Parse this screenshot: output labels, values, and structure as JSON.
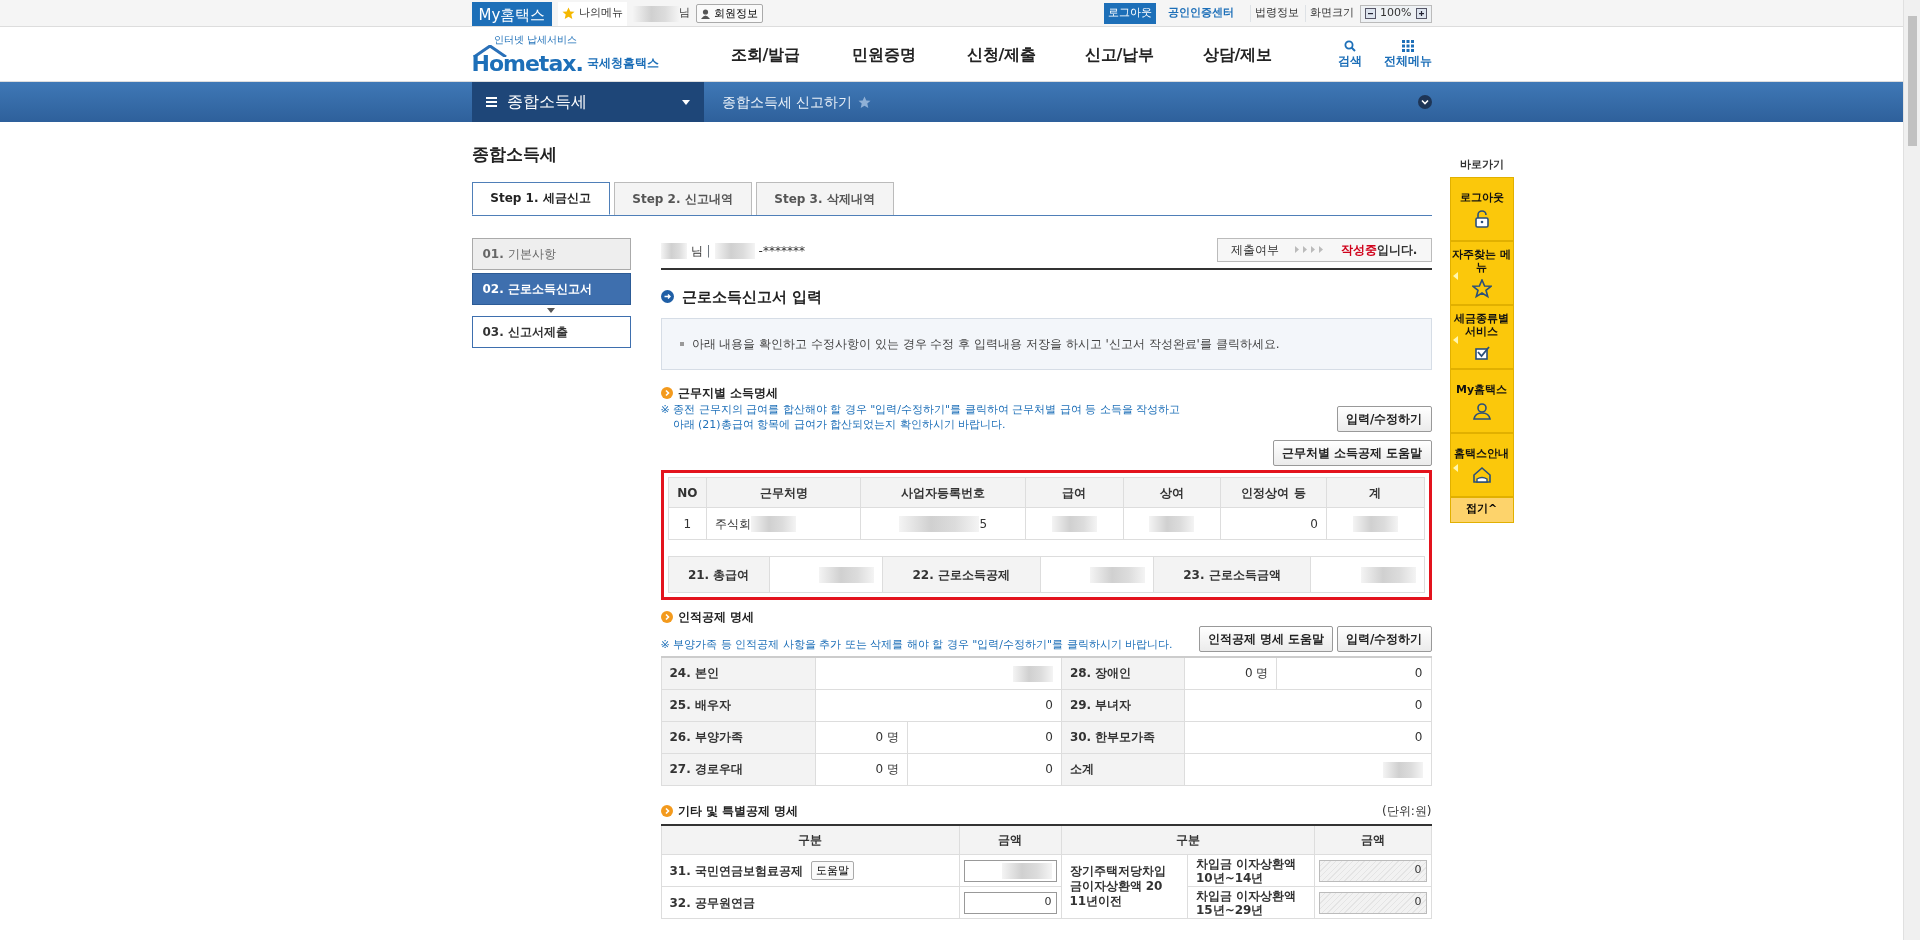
{
  "top_bar": {
    "brand": "My홈택스",
    "my_menu": "나의메뉴",
    "user_suffix": "님",
    "member_info": "회원정보",
    "logout": "로그아웃",
    "cert_center": "공인인증센터",
    "links": [
      "법령정보",
      "화면크기"
    ],
    "zoom": "100%"
  },
  "header": {
    "logo_tagline": "인터넷 납세서비스",
    "logo": "Hometax.",
    "logo_name": "국세청홈택스",
    "menu": [
      "조회/발급",
      "민원증명",
      "신청/제출",
      "신고/납부",
      "상담/제보"
    ],
    "search": "검색",
    "all_menu": "전체메뉴"
  },
  "breadcrumb": {
    "section": "종합소득세",
    "page": "종합소득세 신고하기",
    "favorite": false
  },
  "page_title": "종합소득세",
  "tabs": [
    {
      "label": "Step 1. 세금신고",
      "selected": true
    },
    {
      "label": "Step 2. 신고내역",
      "selected": false
    },
    {
      "label": "Step 3. 삭제내역",
      "selected": false
    }
  ],
  "steps": [
    {
      "number": "01.",
      "label": "기본사항",
      "selected": false,
      "completed": true
    },
    {
      "number": "02.",
      "label": "근로소득신고서",
      "selected": true,
      "completed": false
    },
    {
      "number": "03.",
      "label": "신고서제출",
      "selected": false,
      "completed": false
    }
  ],
  "user_line": {
    "suffix": "님",
    "separator": "|",
    "masked_id": "-*******"
  },
  "submit_status": {
    "label": "제출여부",
    "status": "작성중",
    "suffix": "입니다."
  },
  "form_title": "근로소득신고서 입력",
  "notice": "아래 내용을 확인하고 수정사항이 있는 경우 수정 후 입력내용 저장을 하시고 '신고서 작성완료'를 클릭하세요.",
  "income_section": {
    "title": "근무지별 소득명세",
    "notes": [
      "※ 종전 근무지의 급여를 합산해야 할 경우 \"입력/수정하기\"를 클릭하여 근무처별 급여 등 소득을 작성하고",
      "아래 (21)총급여 항목에 급여가 합산되었는지 확인하시기 바랍니다."
    ],
    "edit_button": "입력/수정하기",
    "help_button": "근무처별 소득공제 도움말",
    "highlighted": true,
    "columns": [
      "NO",
      "근무처명",
      "사업자등록번호",
      "급여",
      "상여",
      "인정상여 등",
      "계"
    ],
    "rows": [
      [
        {
          "text": "1"
        },
        {
          "text": "주식회",
          "redacted": true
        },
        {
          "redacted": true,
          "suffix": "5"
        },
        {
          "redacted": true
        },
        {
          "redacted": true
        },
        {
          "text": "0"
        },
        {
          "redacted": true
        }
      ]
    ],
    "totals": [
      {
        "label": "21. 총급여",
        "redacted": true
      },
      {
        "label": "22. 근로소득공제",
        "redacted": true
      },
      {
        "label": "23. 근로소득금액",
        "redacted": true
      }
    ]
  },
  "personal_section": {
    "title": "인적공제 명세",
    "note": "※ 부양가족 등 인적공제 사항을 추가 또는 삭제를 해야 할 경우 \"입력/수정하기\"를 클릭하시기 바랍니다.",
    "help_button": "인적공제 명세 도움말",
    "edit_button": "입력/수정하기",
    "rows": [
      [
        {
          "label": "24. 본인",
          "redacted": true
        },
        {
          "label": "28. 장애인",
          "count": "0 명",
          "amount": "0"
        }
      ],
      [
        {
          "label": "25. 배우자",
          "amount": "0"
        },
        {
          "label": "29. 부녀자",
          "amount": "0"
        }
      ],
      [
        {
          "label": "26. 부양가족",
          "count": "0 명",
          "amount": "0"
        },
        {
          "label": "30. 한부모가족",
          "amount": "0"
        }
      ],
      [
        {
          "label": "27. 경로우대",
          "count": "0 명",
          "amount": "0"
        },
        {
          "label": "소계",
          "redacted": true
        }
      ]
    ]
  },
  "other_section": {
    "title": "기타 및 특별공제 명세",
    "unit": "(단위:원)",
    "columns": [
      "구분",
      "금액",
      "구분",
      "금액"
    ],
    "left_rows": [
      {
        "label": "31. 국민연금보험료공제",
        "help_button": "도움말",
        "redacted": true
      },
      {
        "label": "32. 공무원연금",
        "value": "0"
      }
    ],
    "group_label": "장기주택저당차입금이자상환액 2011년이전",
    "right_rows": [
      {
        "label": "차입금 이자상환액 10년~14년",
        "value": "0",
        "disabled": true
      },
      {
        "label": "차입금 이자상환액 15년~29년",
        "value": "0",
        "disabled": true
      }
    ]
  },
  "quick_menu": {
    "title": "바로가기",
    "items": [
      {
        "label": "로그아웃",
        "kind": "lock",
        "expandable": false
      },
      {
        "label": "자주찾는 메뉴",
        "kind": "star",
        "expandable": true
      },
      {
        "label": "세금종류별 서비스",
        "kind": "check",
        "expandable": true
      },
      {
        "label": "My홈택스",
        "kind": "person",
        "expandable": false
      },
      {
        "label": "홈택스안내",
        "kind": "house",
        "expandable": true
      }
    ],
    "collapse": "접기^"
  }
}
